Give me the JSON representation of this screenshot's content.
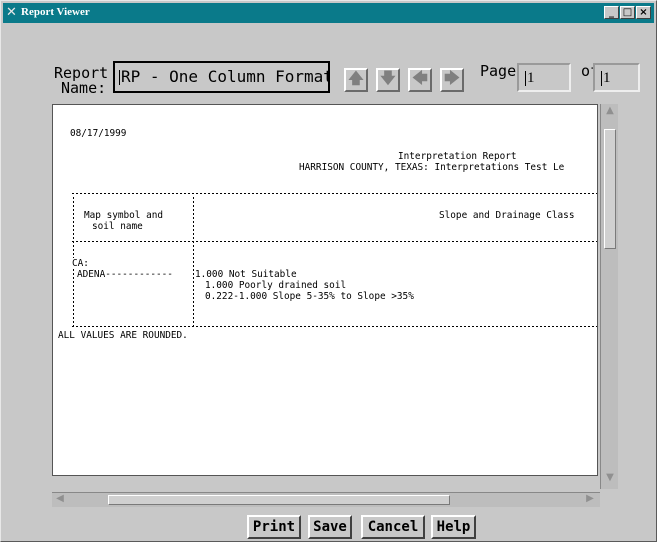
{
  "window": {
    "title": "Report Viewer",
    "controls": {
      "minimize": "_",
      "maximize": "□",
      "close": "×"
    }
  },
  "toolbar": {
    "report_label_line1": "Report",
    "report_label_line2": "Name:",
    "report_name": "RP - One Column Format",
    "page_label": "Page",
    "page_value": "1",
    "of_label": "of",
    "total_pages": "1",
    "nav_icons": [
      "arrow-up-icon",
      "arrow-down-icon",
      "arrow-left-icon",
      "arrow-right-icon"
    ]
  },
  "report": {
    "date": "08/17/1999",
    "title": "Interpretation Report",
    "subtitle": "HARRISON COUNTY, TEXAS: Interpretations Test Le",
    "col1_header_line1": "Map symbol and",
    "col1_header_line2": "soil name",
    "col2_header": "Slope and Drainage Class",
    "map_symbol": "CA:",
    "soil_name": "ADENA------------",
    "row_line1": "1.000 Not Suitable",
    "row_line2": "1.000 Poorly drained soil",
    "row_line3": "0.222-1.000 Slope 5-35% to Slope >35%",
    "footer": "ALL VALUES ARE ROUNDED."
  },
  "buttons": {
    "print": "Print",
    "save": "Save",
    "cancel": "Cancel",
    "help": "Help"
  },
  "colors": {
    "title_bar": "#0a7a8a",
    "window_bg": "#c8c8c8",
    "report_bg": "#ffffff"
  }
}
